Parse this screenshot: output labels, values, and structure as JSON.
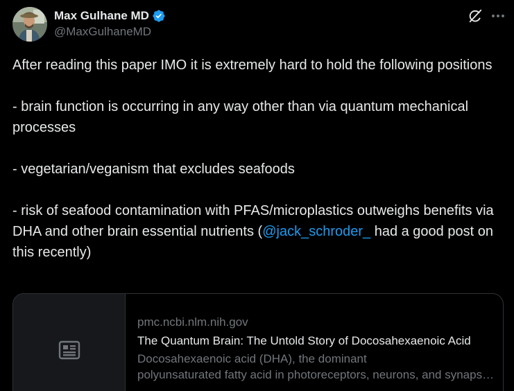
{
  "author": {
    "display_name": "Max Gulhane MD",
    "handle": "@MaxGulhaneMD"
  },
  "icons": {
    "avatar": "avatar",
    "verified": "verified-badge-icon",
    "grok": "grok-icon",
    "more": "more-icon",
    "article": "article-icon"
  },
  "colors": {
    "background": "#000000",
    "text": "#e7e9ea",
    "secondary": "#71767b",
    "link": "#1d9bf0"
  },
  "tweet": {
    "intro": "After reading this paper IMO it is extremely hard to hold the following positions",
    "point1": "- brain function is occurring in any way other than via quantum mechanical processes",
    "point2": "- vegetarian/veganism that excludes seafoods",
    "point3_before": "- risk of seafood contamination with PFAS/microplastics outweighs benefits via DHA and other brain essential nutrients (",
    "mention": "@jack_schroder_",
    "point3_after": " had a good post on this recently)"
  },
  "card": {
    "domain": "pmc.ncbi.nlm.nih.gov",
    "title": "The Quantum Brain: The Untold Story of Docosahexaenoic Acid",
    "desc_line1": "Docosahexaenoic acid (DHA), the dominant",
    "desc_line2": "polyunsaturated fatty acid in photoreceptors, neurons, and synapses"
  }
}
